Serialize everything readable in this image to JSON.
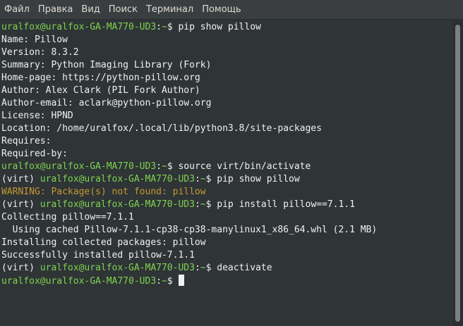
{
  "menu": [
    "Файл",
    "Правка",
    "Вид",
    "Поиск",
    "Терминал",
    "Помощь"
  ],
  "prompt": {
    "user_host": "uralfox@uralfox-GA-MA770-UD3",
    "sep": ":",
    "path": "~",
    "dollar": "$ ",
    "venv": "(virt) "
  },
  "lines": [
    {
      "kind": "prompt",
      "cmd": "pip show pillow"
    },
    {
      "kind": "out",
      "text": "Name: Pillow"
    },
    {
      "kind": "out",
      "text": "Version: 8.3.2"
    },
    {
      "kind": "out",
      "text": "Summary: Python Imaging Library (Fork)"
    },
    {
      "kind": "out",
      "text": "Home-page: https://python-pillow.org"
    },
    {
      "kind": "out",
      "text": "Author: Alex Clark (PIL Fork Author)"
    },
    {
      "kind": "out",
      "text": "Author-email: aclark@python-pillow.org"
    },
    {
      "kind": "out",
      "text": "License: HPND"
    },
    {
      "kind": "out",
      "text": "Location: /home/uralfox/.local/lib/python3.8/site-packages"
    },
    {
      "kind": "out",
      "text": "Requires:"
    },
    {
      "kind": "out",
      "text": "Required-by:"
    },
    {
      "kind": "prompt",
      "cmd": "source virt/bin/activate"
    },
    {
      "kind": "vprompt",
      "cmd": "pip show pillow"
    },
    {
      "kind": "warn",
      "text": "WARNING: Package(s) not found: pillow"
    },
    {
      "kind": "vprompt",
      "cmd": "pip install pillow==7.1.1"
    },
    {
      "kind": "out",
      "text": "Collecting pillow==7.1.1"
    },
    {
      "kind": "out",
      "text": "  Using cached Pillow-7.1.1-cp38-cp38-manylinux1_x86_64.whl (2.1 MB)"
    },
    {
      "kind": "out",
      "text": "Installing collected packages: pillow"
    },
    {
      "kind": "out",
      "text": "Successfully installed pillow-7.1.1"
    },
    {
      "kind": "vprompt",
      "cmd": "deactivate"
    },
    {
      "kind": "prompt",
      "cmd": "",
      "cursor": true
    }
  ],
  "colors": {
    "background": "#2f3437",
    "prompt_green": "#7fd34e",
    "warning": "#c49a2e",
    "text": "#f0f0f0"
  }
}
